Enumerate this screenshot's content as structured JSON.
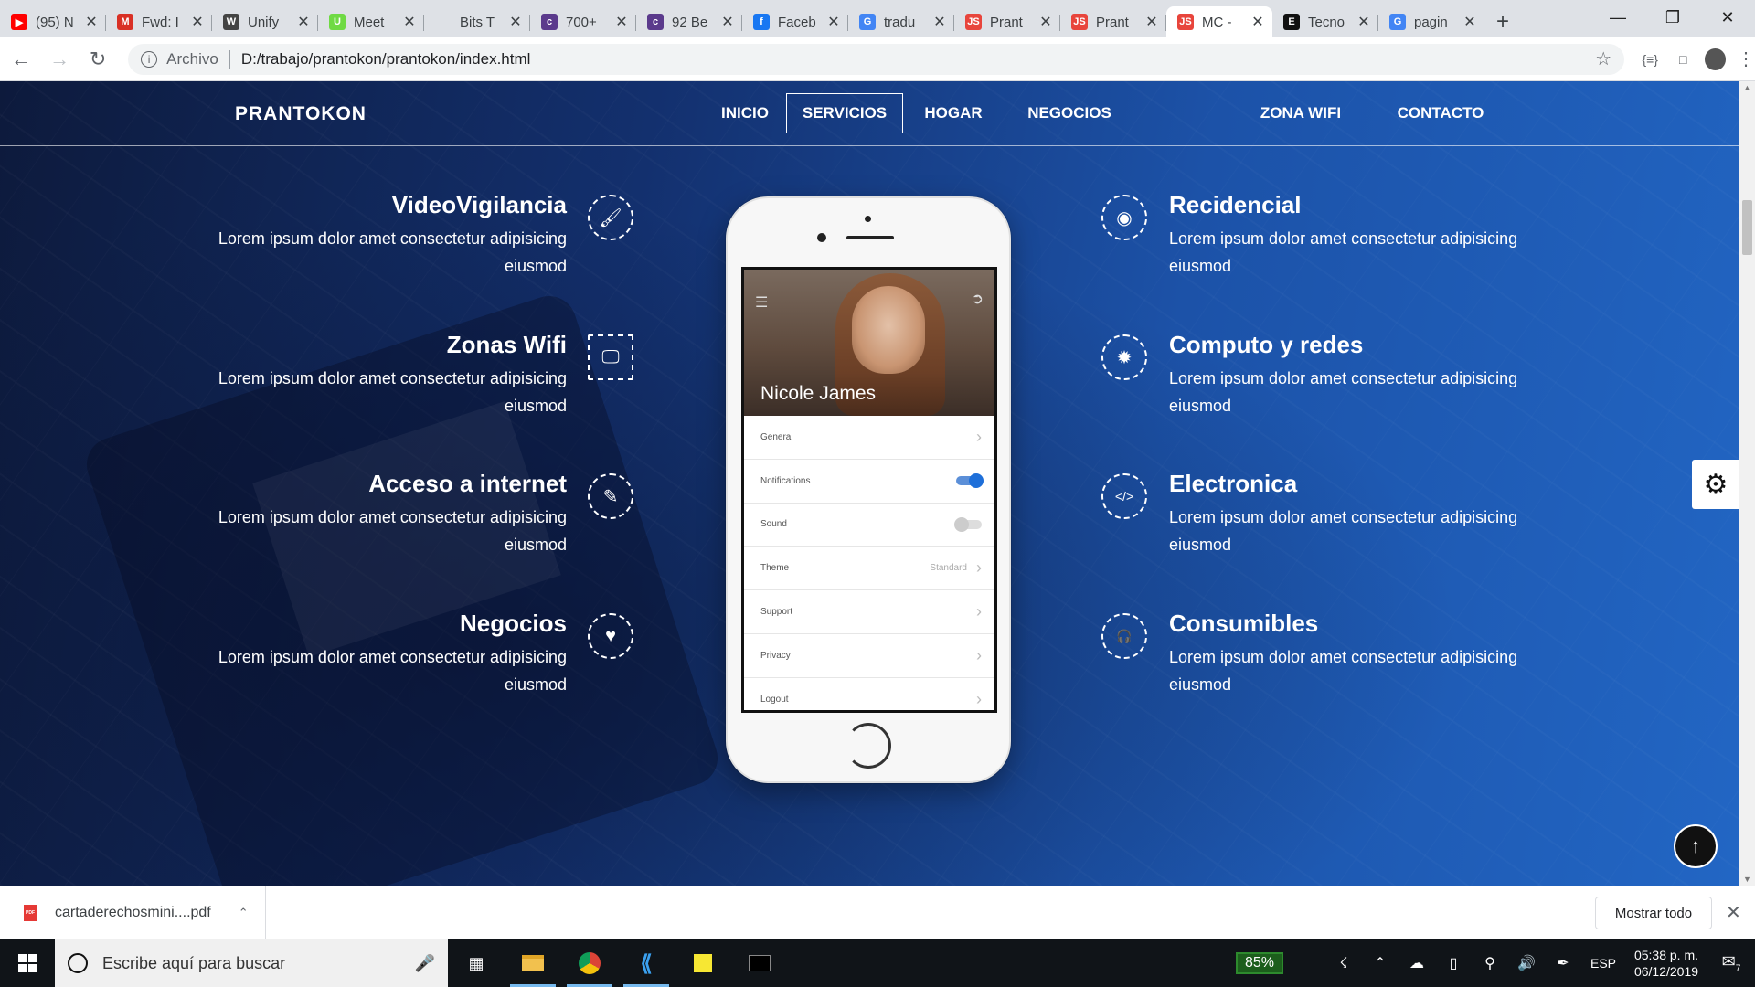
{
  "browser": {
    "tabs": [
      {
        "label": "(95) N",
        "icon": "youtube-icon",
        "color": "#ff0000",
        "glyph": "▶"
      },
      {
        "label": "Fwd: I",
        "icon": "gmail-icon",
        "color": "#d93025",
        "glyph": "M"
      },
      {
        "label": "Unify",
        "icon": "wordpress-icon",
        "color": "#444444",
        "glyph": "W"
      },
      {
        "label": "Meet",
        "icon": "upwork-icon",
        "color": "#6fda44",
        "glyph": "U"
      },
      {
        "label": "Bits T",
        "icon": "blank-page-icon",
        "color": "#dee1e6",
        "glyph": ""
      },
      {
        "label": "700+",
        "icon": "colorlib-icon",
        "color": "#5b3a8c",
        "glyph": "c"
      },
      {
        "label": "92 Be",
        "icon": "colorlib-icon",
        "color": "#5b3a8c",
        "glyph": "c"
      },
      {
        "label": "Faceb",
        "icon": "facebook-icon",
        "color": "#1877f2",
        "glyph": "f"
      },
      {
        "label": "tradu",
        "icon": "google-icon",
        "color": "#4285f4",
        "glyph": "G"
      },
      {
        "label": "Prant",
        "icon": "js-icon",
        "color": "#e8453c",
        "glyph": "JS"
      },
      {
        "label": "Prant",
        "icon": "js-icon",
        "color": "#e8453c",
        "glyph": "JS"
      },
      {
        "label": "MC -",
        "icon": "js-icon",
        "color": "#e8453c",
        "glyph": "JS"
      },
      {
        "label": "Tecno",
        "icon": "e-icon",
        "color": "#111111",
        "glyph": "E"
      },
      {
        "label": "pagin",
        "icon": "google-icon",
        "color": "#4285f4",
        "glyph": "G"
      }
    ],
    "active_tab_index": 11,
    "address": {
      "scheme": "Archivo",
      "url": "D:/trabajo/prantokon/prantokon/index.html"
    }
  },
  "site": {
    "logo": "PRANTOKON",
    "nav": [
      {
        "label": "INICIO",
        "active": false
      },
      {
        "label": "SERVICIOS",
        "active": true
      },
      {
        "label": "HOGAR",
        "active": false
      },
      {
        "label": "NEGOCIOS",
        "active": false
      },
      {
        "label": "ZONA WIFI",
        "active": false
      },
      {
        "label": "CONTACTO",
        "active": false
      }
    ],
    "services_left": [
      {
        "title": "VideoVigilancia",
        "text": "Lorem ipsum dolor amet consectetur adipisicing eiusmod",
        "icon": "brush-icon",
        "glyph": "🖌"
      },
      {
        "title": "Zonas Wifi",
        "text": "Lorem ipsum dolor amet consectetur adipisicing eiusmod",
        "icon": "monitor-icon",
        "glyph": "🖵"
      },
      {
        "title": "Acceso a internet",
        "text": "Lorem ipsum dolor amet consectetur adipisicing eiusmod",
        "icon": "document-edit-icon",
        "glyph": "✎"
      },
      {
        "title": "Negocios",
        "text": "Lorem ipsum dolor amet consectetur adipisicing eiusmod",
        "icon": "heart-pulse-icon",
        "glyph": "♥"
      }
    ],
    "services_right": [
      {
        "title": "Recidencial",
        "text": "Lorem ipsum dolor amet consectetur adipisicing eiusmod",
        "icon": "eye-icon",
        "glyph": "◉"
      },
      {
        "title": "Computo y redes",
        "text": "Lorem ipsum dolor amet consectetur adipisicing eiusmod",
        "icon": "sun-icon",
        "glyph": "✹"
      },
      {
        "title": "Electronica",
        "text": "Lorem ipsum dolor amet consectetur adipisicing eiusmod",
        "icon": "code-icon",
        "glyph": "</>"
      },
      {
        "title": "Consumibles",
        "text": "Lorem ipsum dolor amet consectetur adipisicing eiusmod",
        "icon": "headphones-icon",
        "glyph": "🎧"
      }
    ],
    "phone": {
      "profile_name": "Nicole James",
      "settings": [
        {
          "label": "General",
          "kind": "chevron",
          "value": ""
        },
        {
          "label": "Notifications",
          "kind": "toggle",
          "on": true
        },
        {
          "label": "Sound",
          "kind": "toggle",
          "on": false
        },
        {
          "label": "Theme",
          "kind": "chevron",
          "value": "Standard"
        },
        {
          "label": "Support",
          "kind": "chevron",
          "value": ""
        },
        {
          "label": "Privacy",
          "kind": "chevron",
          "value": ""
        },
        {
          "label": "Logout",
          "kind": "chevron",
          "value": ""
        }
      ]
    }
  },
  "downloads": {
    "file": "cartaderechosmini....pdf",
    "show_all": "Mostrar todo"
  },
  "taskbar": {
    "search_placeholder": "Escribe aquí para buscar",
    "battery": "85%",
    "language": "ESP",
    "time": "05:38 p. m.",
    "date": "06/12/2019",
    "notifications": "7"
  }
}
